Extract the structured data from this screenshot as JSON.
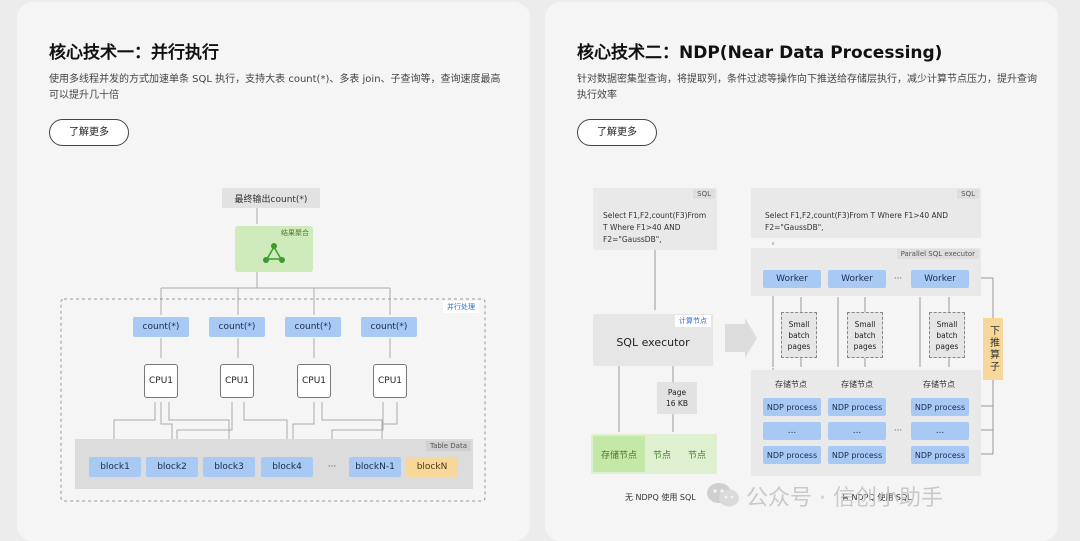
{
  "left": {
    "title": "核心技术一：并行执行",
    "desc": "使用多线程并发的方式加速单条 SQL 执行，支持大表 count(*)、多表 join、子查询等，查询速度最高可以提升几十倍",
    "more_label": "了解更多",
    "final_output": "最终输出count(*)",
    "aggregate_label": "结果聚合",
    "parallel_label": "并行处理",
    "count_label": "count(*)",
    "cpu_label": "CPU1",
    "table_label": "Table Data",
    "blocks": [
      "block1",
      "block2",
      "block3",
      "block4",
      "···",
      "blockN-1",
      "blockN"
    ]
  },
  "right": {
    "title": "核心技术二：NDP(Near Data Processing)",
    "desc": "针对数据密集型查询，将提取列，条件过滤等操作向下推送给存储层执行，减少计算节点压力，提升查询执行效率",
    "more_label": "了解更多",
    "sql_tag": "SQL",
    "sql_text_left": "Select F1,F2,count(F3)From T Where F1>40 AND F2=\"GaussDB\",",
    "sql_text_right": "Select F1,F2,count(F3)From T Where F1>40 AND F2=\"GaussDB\",",
    "compute_node_label": "计算节点",
    "sql_executor": "SQL executor",
    "page_label": "Page\n16 KB",
    "storage_left": [
      "存储节点",
      "节点",
      "节点"
    ],
    "no_ndp_caption": "无 NDPQ 使用 SQL",
    "ndp_caption": "有 NDPQ 使用 SQL",
    "parallel_exec_label": "Parallel SQL executor",
    "worker_label": "Worker",
    "ellipsis": "···",
    "small_batch": "Small\nbatch\npages",
    "pushdown_label": "下推算子",
    "storage_label": "存储节点",
    "ndp_process": "NDP process",
    "dots": "..."
  },
  "watermark": "公众号 · 信创小助手",
  "colors": {
    "blue": "#a9c9f5",
    "green": "#cfeabb",
    "orange": "#f8d79a",
    "card": "#f5f5f5"
  }
}
